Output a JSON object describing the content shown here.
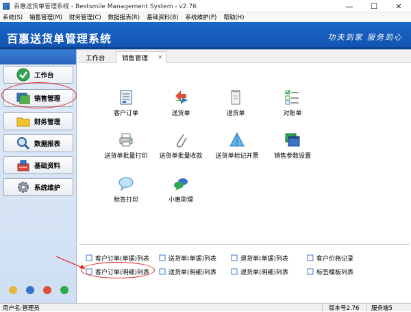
{
  "window": {
    "title": "百惠送货单管理系统 - Bestsmile Management System - v2.76",
    "minimize": "—",
    "maximize": "☐",
    "close": "✕"
  },
  "menu": [
    {
      "label": "系统(S)"
    },
    {
      "label": "销售管理(M)"
    },
    {
      "label": "财务管理(C)"
    },
    {
      "label": "数据报表(R)"
    },
    {
      "label": "基础资料(B)"
    },
    {
      "label": "系统维护(P)"
    },
    {
      "label": "帮助(H)"
    }
  ],
  "banner": {
    "title": "百惠送货单管理系统",
    "slogan": "功夫到家 服务到心"
  },
  "sidebar": {
    "items": [
      {
        "label": "工作台",
        "icon": "check-icon"
      },
      {
        "label": "销售管理",
        "icon": "sales-icon"
      },
      {
        "label": "财务管理",
        "icon": "folder-icon"
      },
      {
        "label": "数据报表",
        "icon": "search-icon"
      },
      {
        "label": "基础资料",
        "icon": "tools-icon"
      },
      {
        "label": "系统维护",
        "icon": "gear-icon"
      }
    ]
  },
  "tabs": {
    "workbench": "工作台",
    "sales": "销售管理",
    "close": "×"
  },
  "functions": [
    {
      "label": "客户订单",
      "icon": "order-form-icon"
    },
    {
      "label": "送货单",
      "icon": "delivery-arrows-icon"
    },
    {
      "label": "退货单",
      "icon": "return-doc-icon"
    },
    {
      "label": "对账单",
      "icon": "checklist-icon"
    },
    {
      "label": "送货单批量打印",
      "icon": "printer-icon"
    },
    {
      "label": "送货单批量收款",
      "icon": "paperclip-icon"
    },
    {
      "label": "送货单标记开票",
      "icon": "pyramid-icon"
    },
    {
      "label": "销售参数设置",
      "icon": "window-settings-icon"
    },
    {
      "label": "标签打印",
      "icon": "speech-bubble-icon"
    },
    {
      "label": "小惠助理",
      "icon": "chat-bubbles-icon"
    }
  ],
  "links": [
    {
      "label": "客户订单(单据)列表"
    },
    {
      "label": "送货单(单据)列表"
    },
    {
      "label": "退货单(单据)列表"
    },
    {
      "label": "客户价格记录"
    },
    {
      "label": "客户订单(明细)列表"
    },
    {
      "label": "送货单(明细)列表"
    },
    {
      "label": "退货单(明细)列表"
    },
    {
      "label": "标签模板列表"
    }
  ],
  "status": {
    "user": "用户名:管理员",
    "version": "版本号2.76",
    "server": "服务端5"
  },
  "colors": {
    "banner": "#1a67c9",
    "annotation": "#e02020"
  }
}
